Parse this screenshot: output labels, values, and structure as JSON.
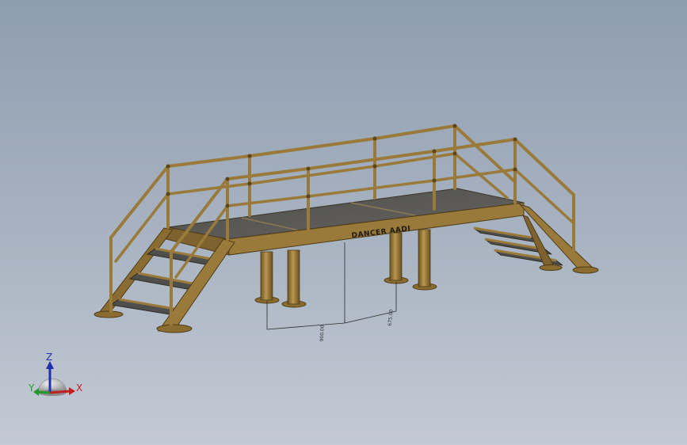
{
  "viewport": {
    "background_top": "#8e9db0",
    "background_bottom": "#c3cad4"
  },
  "model": {
    "structure_color": "#9a7a3a",
    "deck_color": "#5a5a58",
    "platform_label": "DANCER AADI",
    "dimension_left": "900.00",
    "dimension_right": "675.00"
  },
  "triad": {
    "z_label": "Z",
    "x_label": "X",
    "y_label": "Y",
    "z_color": "#1f2fb0",
    "x_color": "#c21e1e",
    "y_color": "#1f9a2a"
  }
}
